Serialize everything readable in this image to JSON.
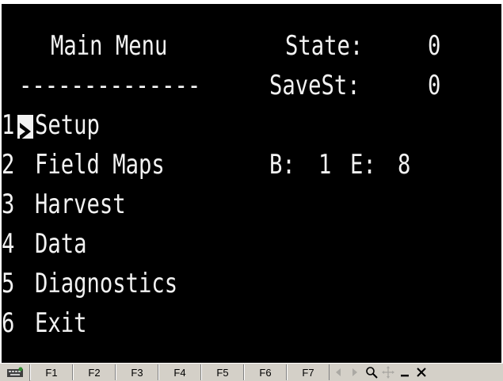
{
  "screen": {
    "title": "Main Menu",
    "divider": "--------------",
    "status": [
      {
        "label": "State:",
        "value": "0"
      },
      {
        "label": "SaveSt:",
        "value": "0"
      }
    ],
    "menu_items": [
      {
        "number": "1",
        "label": "Setup",
        "selected": true
      },
      {
        "number": "2",
        "label": "Field Maps",
        "selected": false
      },
      {
        "number": "3",
        "label": "Harvest",
        "selected": false
      },
      {
        "number": "4",
        "label": "Data",
        "selected": false
      },
      {
        "number": "5",
        "label": "Diagnostics",
        "selected": false
      },
      {
        "number": "6",
        "label": "Exit",
        "selected": false
      }
    ],
    "field_map_info": {
      "b_label": "B:",
      "b_value": "1",
      "e_label": "E:",
      "e_value": "8"
    }
  },
  "toolbar": {
    "function_keys": [
      "F1",
      "F2",
      "F3",
      "F4",
      "F5",
      "F6",
      "F7"
    ],
    "icons": [
      "keyboard-icon",
      "arrow-left-icon",
      "arrow-right-icon",
      "zoom-icon",
      "pan-icon",
      "minimize-icon",
      "close-icon"
    ]
  },
  "colors": {
    "screen_background": "#000000",
    "screen_text": "#f2f2f2",
    "toolbar_background": "#d4d0c8"
  }
}
